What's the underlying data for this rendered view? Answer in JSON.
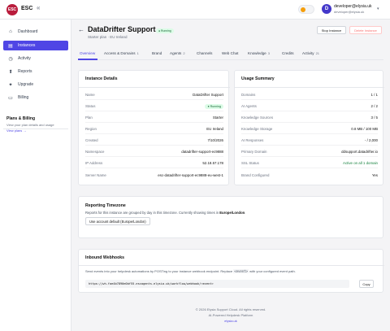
{
  "header": {
    "logo_text": "ESC",
    "brand": "ESC",
    "collapse_glyph": "«",
    "avatar_initial": "D",
    "user_name": "developer@elysia.uk",
    "user_email": "developer@elysia.uk",
    "caret": "▾"
  },
  "sidebar": {
    "items": [
      {
        "label": "Dashboard",
        "icon": "⌂"
      },
      {
        "label": "Instances",
        "icon": "▤"
      },
      {
        "label": "Activity",
        "icon": "◷"
      },
      {
        "label": "Reports",
        "icon": "⬆"
      },
      {
        "label": "Upgrade",
        "icon": "✦"
      },
      {
        "label": "Billing",
        "icon": "▭"
      }
    ],
    "plans_title": "Plans & Billing",
    "plans_text": "View your plan details and usage",
    "plans_link": "View plans →"
  },
  "page": {
    "back_glyph": "←",
    "title": "DataDrifter Support",
    "status": "● Running",
    "subtitle": "Starter plan · EU Ireland",
    "stop_label": "Stop Instance",
    "delete_label": "Delete Instance"
  },
  "tabs": [
    {
      "label": "Overview",
      "count": ""
    },
    {
      "label": "Access & Domains",
      "count": "1"
    },
    {
      "label": "Brand",
      "count": ""
    },
    {
      "label": "Agents",
      "count": "2"
    },
    {
      "label": "Channels",
      "count": ""
    },
    {
      "label": "Web Chat",
      "count": ""
    },
    {
      "label": "Knowledge",
      "count": "3"
    },
    {
      "label": "Credits",
      "count": ""
    },
    {
      "label": "Activity",
      "count": "21"
    }
  ],
  "instance_details": {
    "title": "Instance Details",
    "rows": [
      {
        "k": "Name",
        "v": "DataDrifter Support"
      },
      {
        "k": "Status",
        "v": "● Running"
      },
      {
        "k": "Plan",
        "v": "Starter"
      },
      {
        "k": "Region",
        "v": "EU Ireland"
      },
      {
        "k": "Created",
        "v": "7/10/2026"
      },
      {
        "k": "Namespace",
        "v": "datadrifter-support-ec9888"
      },
      {
        "k": "IP Address",
        "v": "52.18.57.178"
      },
      {
        "k": "Server Name",
        "v": "esc-datadrifter-support-ec9888-eu-west-1"
      }
    ]
  },
  "usage_summary": {
    "title": "Usage Summary",
    "rows": [
      {
        "k": "Domains",
        "v": "1 / 1"
      },
      {
        "k": "AI Agents",
        "v": "2 / 2"
      },
      {
        "k": "Knowledge Sources",
        "v": "3 / 5"
      },
      {
        "k": "Knowledge Storage",
        "v": "0.8 MB / 100 MB"
      },
      {
        "k": "AI Responses",
        "v": "- / 2,000"
      },
      {
        "k": "Primary Domain",
        "v": "ddsupport.datadrifter.io"
      },
      {
        "k": "SSL Status",
        "v": "Active on all 1 domain"
      },
      {
        "k": "Brand Configured",
        "v": "Yes"
      }
    ]
  },
  "timezone": {
    "title": "Reporting Timezone",
    "desc_prefix": "Reports for this instance are grouped by day in this timezone. Currently showing times in ",
    "desc_zone": "Europe/London",
    "desc_suffix": ".",
    "button": "Use account default (Europe/London)"
  },
  "webhooks": {
    "title": "Inbound Webhooks",
    "desc_prefix": "Send events into your helpdesk automations by POSTing to your instance webhook endpoint. Replace ",
    "desc_code": "<event>",
    "desc_suffix": " with your configured event path.",
    "url": "https://wh-fae4b7890e0bf55.escagents.elysia.uk/workflow/webhook/<event>",
    "copy_label": "Copy"
  },
  "footer": {
    "line1": "© 2026 Elysia Support Cloud. All rights reserved.",
    "line2": "AI-Powered Helpdesk Platform",
    "link": "elysia.uk"
  },
  "colors": {
    "accent": "#4f46e5",
    "brand": "#b91c3c",
    "running": "#15803d"
  }
}
